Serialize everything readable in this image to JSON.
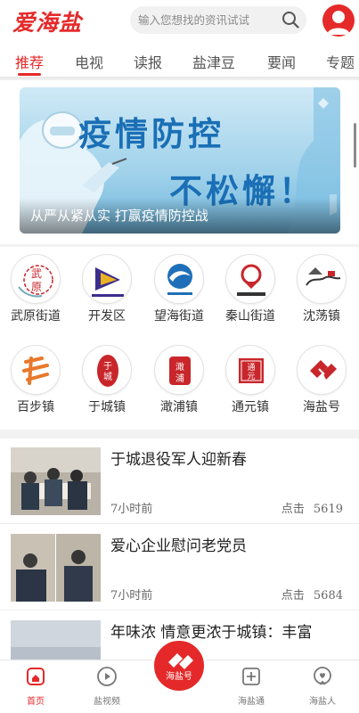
{
  "header": {
    "logo_text": "爱海盐",
    "search_placeholder": "输入您想找的资讯试试",
    "accent_color": "#e5292a"
  },
  "tabs": [
    "推荐",
    "电视",
    "读报",
    "盐津豆",
    "要闻",
    "专题"
  ],
  "active_tab": "推荐",
  "banner": {
    "line1": "疫情防控",
    "line2": "不松懈！",
    "caption": "从严从紧从实  打赢疫情防控战"
  },
  "channels": [
    {
      "label": "武原街道",
      "icon": "wuyuan-logo"
    },
    {
      "label": "开发区",
      "icon": "kaifaqu-logo"
    },
    {
      "label": "望海街道",
      "icon": "wanghai-logo"
    },
    {
      "label": "秦山街道",
      "icon": "qinshan-logo"
    },
    {
      "label": "沈荡镇",
      "icon": "shendang-logo"
    },
    {
      "label": "百步镇",
      "icon": "baibu-logo"
    },
    {
      "label": "于城镇",
      "icon": "yucheng-logo"
    },
    {
      "label": "澉浦镇",
      "icon": "ganpu-logo"
    },
    {
      "label": "通元镇",
      "icon": "tongyuan-logo"
    },
    {
      "label": "海盐号",
      "icon": "haiyanhao-logo"
    }
  ],
  "news": [
    {
      "title": "于城退役军人迎新春",
      "time": "7小时前",
      "clicks_label": "点击",
      "clicks": "5619"
    },
    {
      "title": "爱心企业慰问老党员",
      "time": "7小时前",
      "clicks_label": "点击",
      "clicks": "5684"
    },
    {
      "title": "年味浓 情意更浓于城镇：丰富",
      "time": "",
      "clicks_label": "",
      "clicks": ""
    }
  ],
  "bottom_nav": {
    "home": "首页",
    "video": "盐视频",
    "center": "海盐号",
    "tong": "海盐通",
    "people": "海盐人"
  }
}
